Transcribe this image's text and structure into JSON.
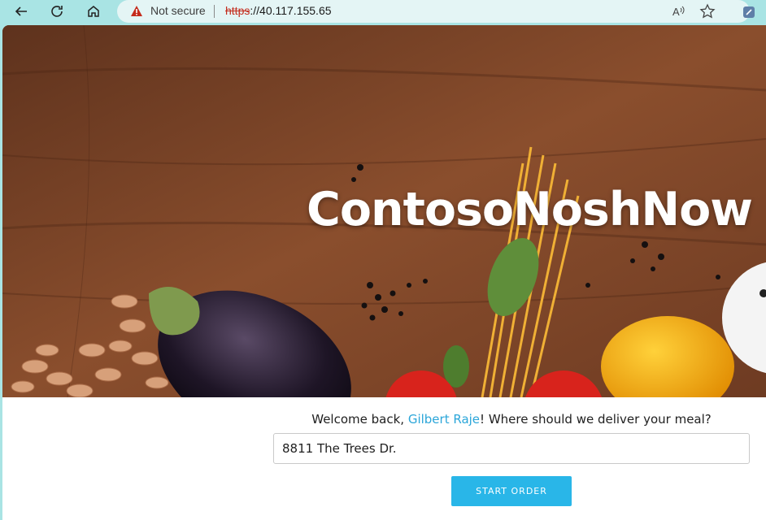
{
  "browser": {
    "security_label": "Not secure",
    "url_protocol": "https",
    "url_rest": "://40.117.155.65"
  },
  "hero": {
    "brand": "ContosoNoshNow"
  },
  "delivery": {
    "welcome_prefix": "Welcome back, ",
    "user_name": "Gilbert Raje",
    "welcome_suffix": "! Where should we deliver your meal?",
    "address_value": "8811 The Trees Dr.",
    "start_button": "START ORDER"
  },
  "colors": {
    "accent": "#29b6e8",
    "link": "#2ba6d9",
    "chrome": "#a9e4e4"
  }
}
